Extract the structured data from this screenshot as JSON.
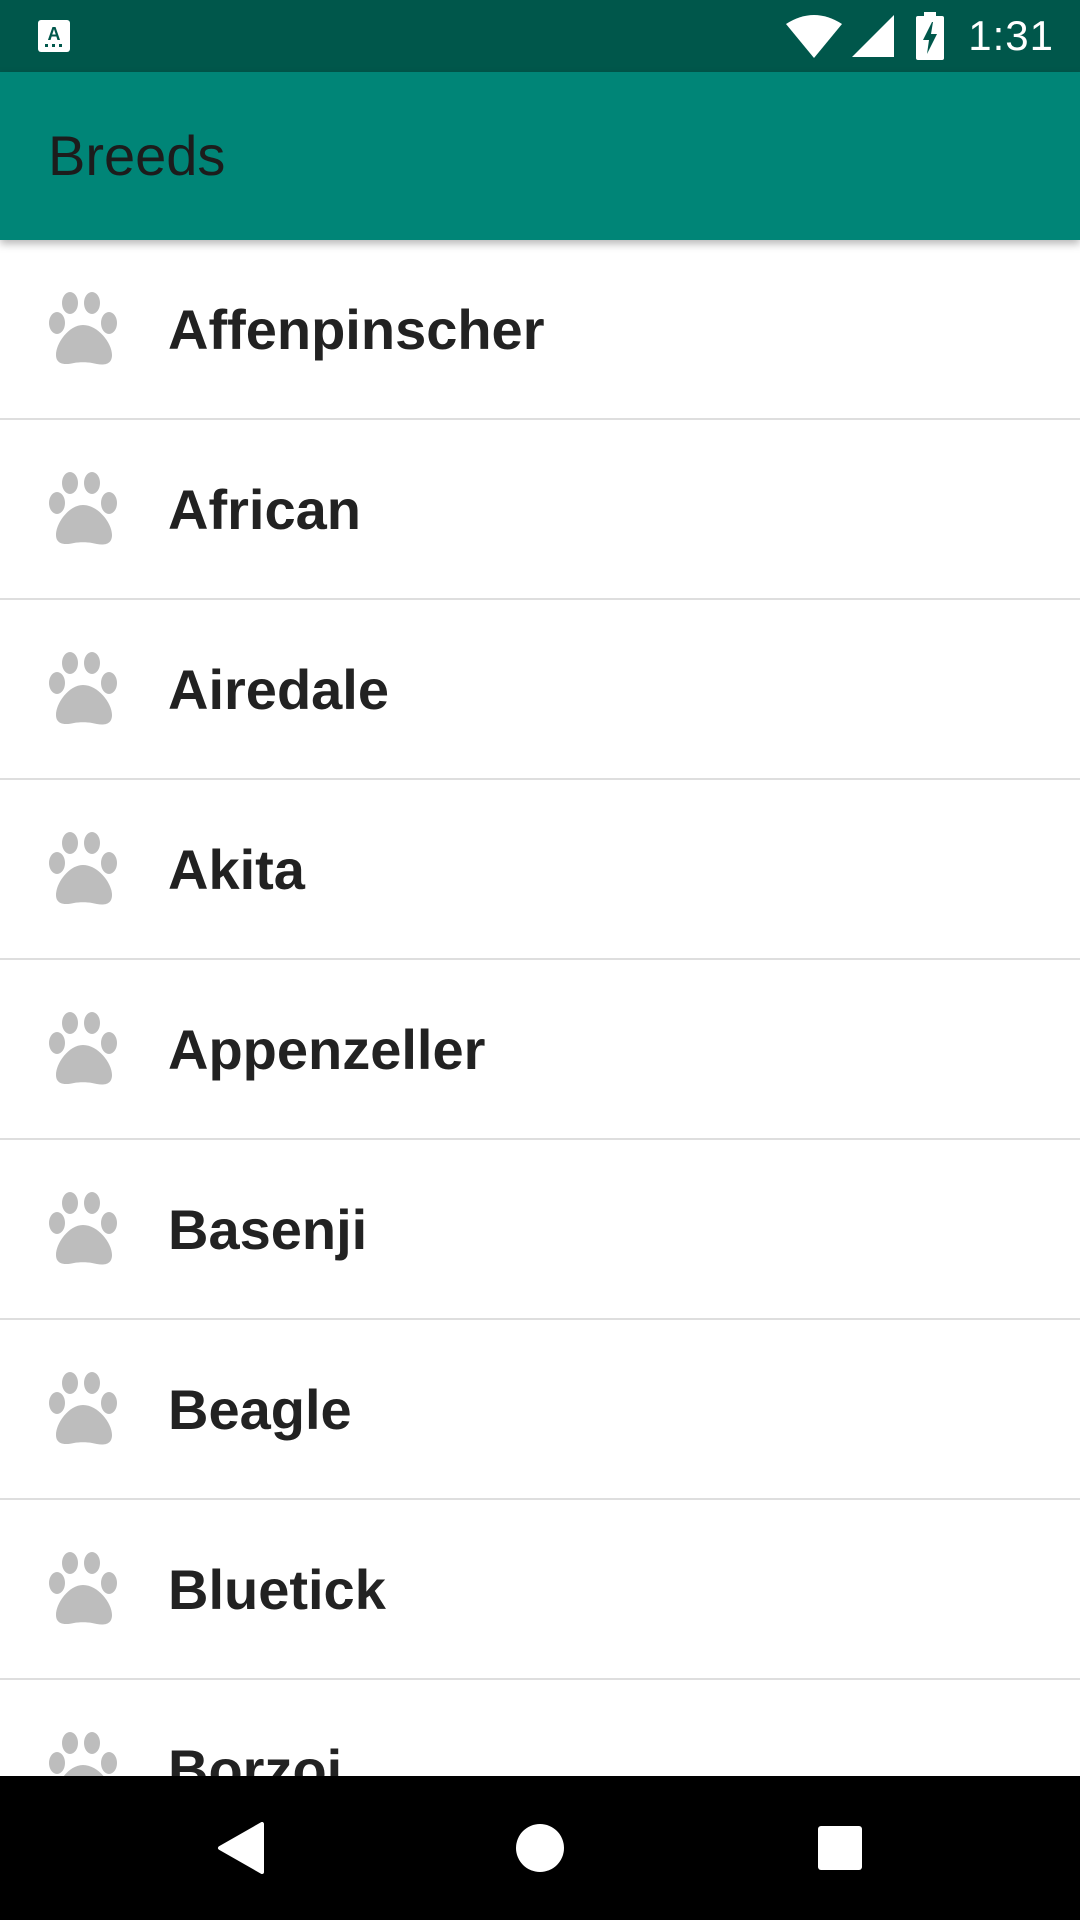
{
  "status_bar": {
    "time": "1:31",
    "icons": [
      "keyboard-icon",
      "wifi-icon",
      "signal-icon",
      "battery-charging-icon"
    ],
    "background": "#00574b"
  },
  "app_bar": {
    "title": "Breeds",
    "background": "#008577"
  },
  "breeds": [
    {
      "name": "Affenpinscher",
      "icon": "paw-icon"
    },
    {
      "name": "African",
      "icon": "paw-icon"
    },
    {
      "name": "Airedale",
      "icon": "paw-icon"
    },
    {
      "name": "Akita",
      "icon": "paw-icon"
    },
    {
      "name": "Appenzeller",
      "icon": "paw-icon"
    },
    {
      "name": "Basenji",
      "icon": "paw-icon"
    },
    {
      "name": "Beagle",
      "icon": "paw-icon"
    },
    {
      "name": "Bluetick",
      "icon": "paw-icon"
    },
    {
      "name": "Borzoi",
      "icon": "paw-icon"
    }
  ],
  "nav_bar": {
    "buttons": [
      "back-icon",
      "home-icon",
      "recents-icon"
    ]
  },
  "colors": {
    "paw": "#bdbdbd",
    "divider": "#dedede",
    "text": "#222222"
  }
}
